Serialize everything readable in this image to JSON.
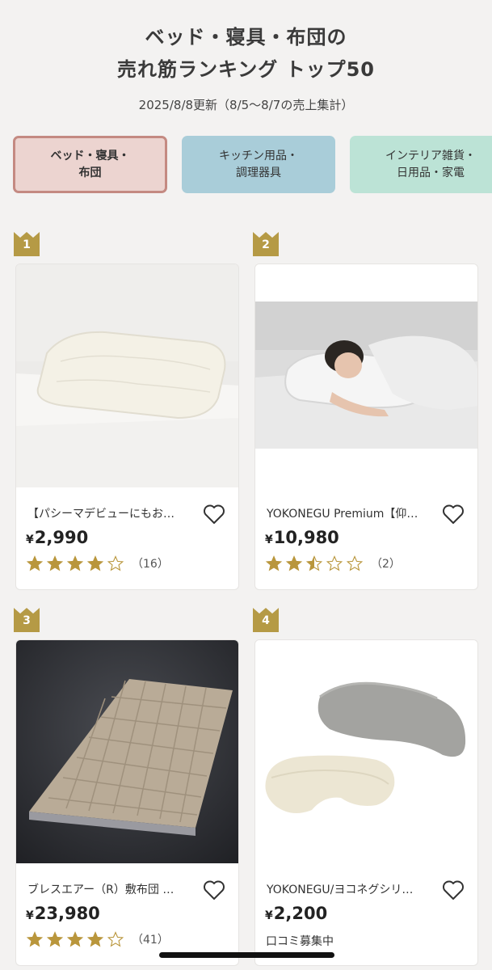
{
  "header": {
    "title_line1": "ベッド・寝具・布団の",
    "title_line2": "売れ筋ランキング トップ50",
    "updated": "2025/8/8更新（8/5〜8/7の売上集計）"
  },
  "tabs": [
    {
      "line1": "ベッド・寝具・",
      "line2": "布団",
      "active": true
    },
    {
      "line1": "キッチン用品・",
      "line2": "調理器具",
      "active": false
    },
    {
      "line1": "インテリア雑貨・",
      "line2": "日用品・家電",
      "active": false
    }
  ],
  "products": [
    {
      "rank": "1",
      "name": "【パシーマデビューにもお…",
      "currency": "¥",
      "price": "2,990",
      "rating": 4,
      "review_count": "（16）"
    },
    {
      "rank": "2",
      "name": "YOKONEGU Premium【仰…",
      "currency": "¥",
      "price": "10,980",
      "rating": 2.5,
      "review_count": "（2）"
    },
    {
      "rank": "3",
      "name": "ブレスエアー（R）敷布団 …",
      "currency": "¥",
      "price": "23,980",
      "rating": 4,
      "review_count": "（41）"
    },
    {
      "rank": "4",
      "name": "YOKONEGU/ヨコネグシリ…",
      "currency": "¥",
      "price": "2,200",
      "review_note": "口コミ募集中"
    }
  ],
  "colors": {
    "accent": "#c48a82",
    "badge_gold": "#b59a45",
    "star_gold": "#b9963c"
  },
  "icons": {
    "heart": "heart-outline-icon",
    "crown": "crown-icon",
    "star": "star-icon"
  }
}
